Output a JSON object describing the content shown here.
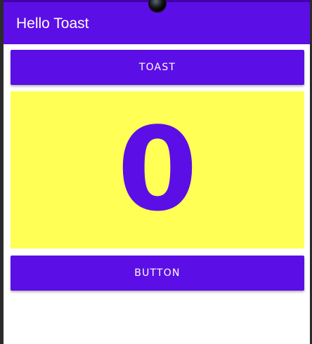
{
  "app_bar": {
    "title": "Hello Toast",
    "color": "#5c0ee6"
  },
  "toast_button": {
    "label": "TOAST"
  },
  "count_display": {
    "value": "0",
    "background": "#ffff55",
    "text_color": "#5c0ee6"
  },
  "count_button": {
    "label": "BUTTON"
  }
}
